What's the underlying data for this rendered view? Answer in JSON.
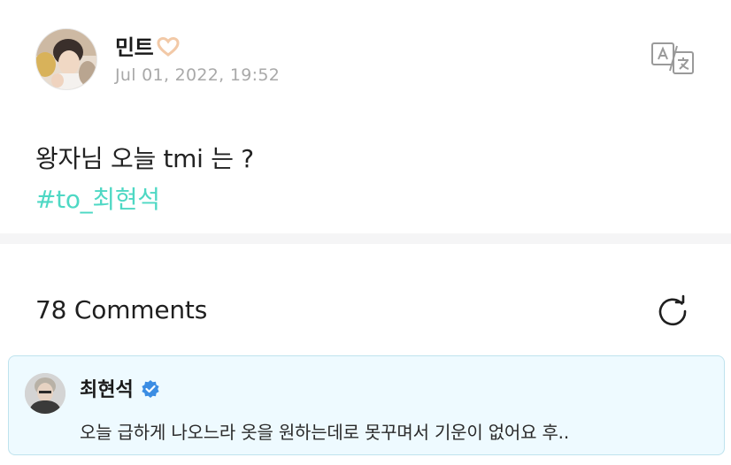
{
  "post": {
    "author_name": "민트",
    "author_emoji": "🫶🏻",
    "date": "Jul 01, 2022, 19:52",
    "text": "왕자님 오늘 tmi 는 ?",
    "hashtag": "#to_최현석",
    "translate_icon": "translate-icon"
  },
  "comments": {
    "count_label": "78 Comments",
    "refresh_icon": "refresh-icon",
    "highlighted": {
      "author_name": "최현석",
      "verified_icon": "verified-badge-icon",
      "text": "오늘 급하게 나오느라 옷을 원하는데로 못꾸며서 기운이 없어요 후.."
    }
  },
  "colors": {
    "hashtag": "#4ed8c4",
    "date": "#a9a9a9",
    "verified": "#3b8de3",
    "comment_bg": "#eefaff",
    "comment_border": "#bfe3ee",
    "divider": "#f5f5f6"
  }
}
